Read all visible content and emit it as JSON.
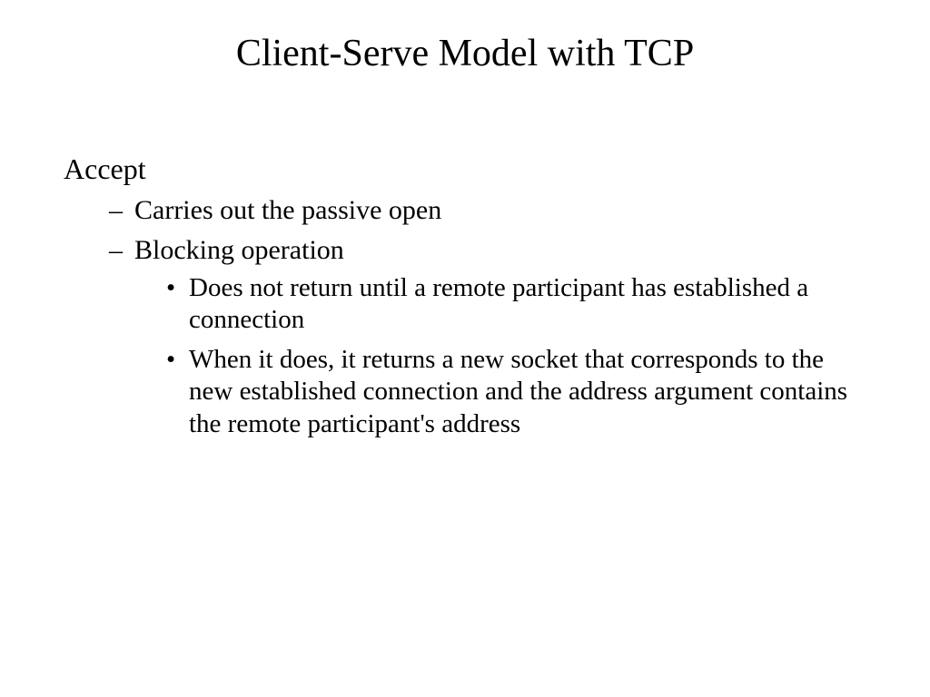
{
  "slide": {
    "title": "Client-Serve Model with TCP",
    "section": "Accept",
    "bullets": {
      "b1": "Carries out the passive open",
      "b2": "Blocking operation",
      "sub": {
        "s1": "Does not return until a remote participant has established a connection",
        "s2": "When it does, it returns a new socket that corresponds to the new established connection and the address argument contains the remote participant's address"
      }
    }
  }
}
